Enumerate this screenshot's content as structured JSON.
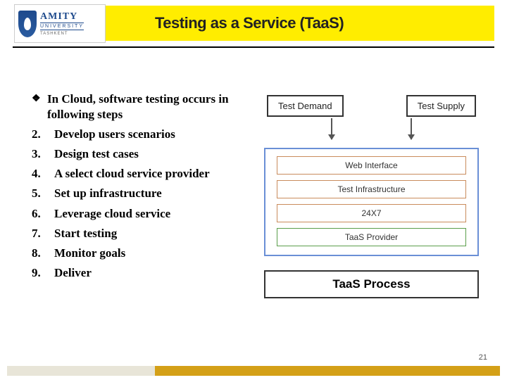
{
  "logo": {
    "name": "AMITY",
    "type": "UNIVERSITY",
    "location": "TASHKENT"
  },
  "title": "Testing as a Service (TaaS)",
  "bullet_intro": "In Cloud, software testing occurs in following steps",
  "steps": [
    {
      "n": "2.",
      "text": "Develop users scenarios"
    },
    {
      "n": "3.",
      "text": "Design test cases"
    },
    {
      "n": "4.",
      "text": "A select cloud service provider"
    },
    {
      "n": "5.",
      "text": "Set up infrastructure"
    },
    {
      "n": "6.",
      "text": "Leverage cloud service"
    },
    {
      "n": "7.",
      "text": "Start testing"
    },
    {
      "n": "8.",
      "text": "Monitor goals"
    },
    {
      "n": "9.",
      "text": "Deliver"
    }
  ],
  "diagram": {
    "top_left": "Test Demand",
    "top_right": "Test Supply",
    "inner": [
      "Web Interface",
      "Test Infrastructure",
      "24X7",
      "TaaS Provider"
    ],
    "caption": "TaaS Process"
  },
  "page_number": "21"
}
